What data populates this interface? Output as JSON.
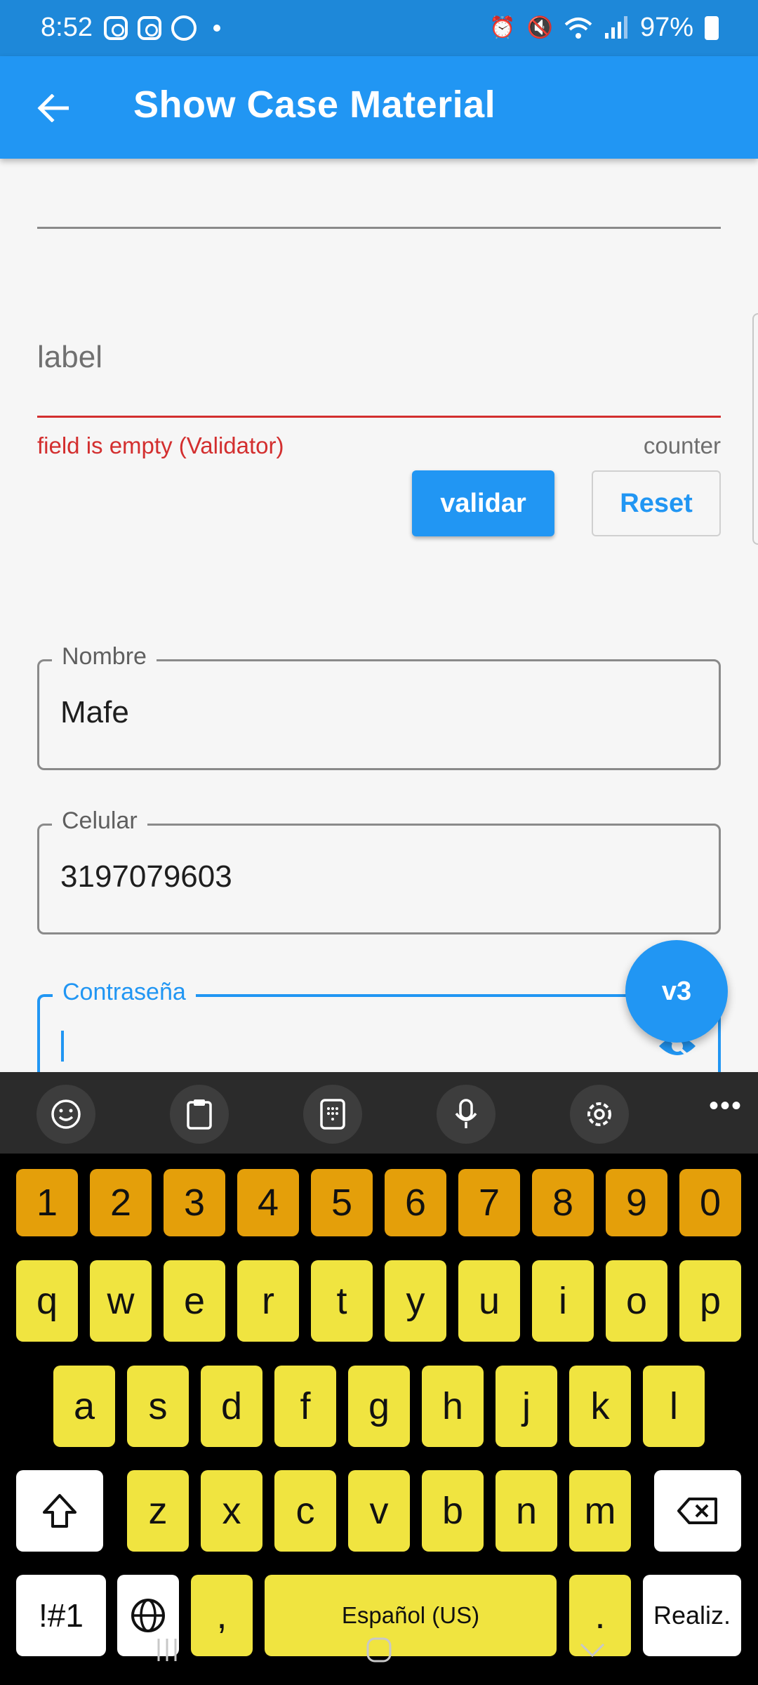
{
  "status_bar": {
    "time": "8:52",
    "battery": "97%"
  },
  "app_bar": {
    "title": "Show Case Material"
  },
  "form": {
    "label_field": {
      "placeholder": "label",
      "error": "field is empty (Validator)",
      "counter": "counter"
    },
    "validar_label": "validar",
    "reset_label": "Reset",
    "nombre": {
      "label": "Nombre",
      "value": "Mafe"
    },
    "celular": {
      "label": "Celular",
      "value": "3197079603"
    },
    "contrasena": {
      "label": "Contraseña",
      "value": ""
    }
  },
  "fab": {
    "label": "v3"
  },
  "keyboard": {
    "toolbar_icons": [
      "emoji-icon",
      "clipboard-icon",
      "keypad-icon",
      "mic-icon",
      "settings-icon",
      "more-icon"
    ],
    "number_row": [
      "1",
      "2",
      "3",
      "4",
      "5",
      "6",
      "7",
      "8",
      "9",
      "0"
    ],
    "row1": [
      "q",
      "w",
      "e",
      "r",
      "t",
      "y",
      "u",
      "i",
      "o",
      "p"
    ],
    "row2": [
      "a",
      "s",
      "d",
      "f",
      "g",
      "h",
      "j",
      "k",
      "l"
    ],
    "row3": [
      "z",
      "x",
      "c",
      "v",
      "b",
      "n",
      "m"
    ],
    "symbols_label": "!#1",
    "comma_label": ",",
    "space_label": "Español (US)",
    "period_label": ".",
    "enter_label": "Realiz."
  },
  "colors": {
    "primary": "#2196f3",
    "error": "#d32f2f",
    "key_letter": "#f0e440",
    "key_number": "#e49f0a"
  }
}
